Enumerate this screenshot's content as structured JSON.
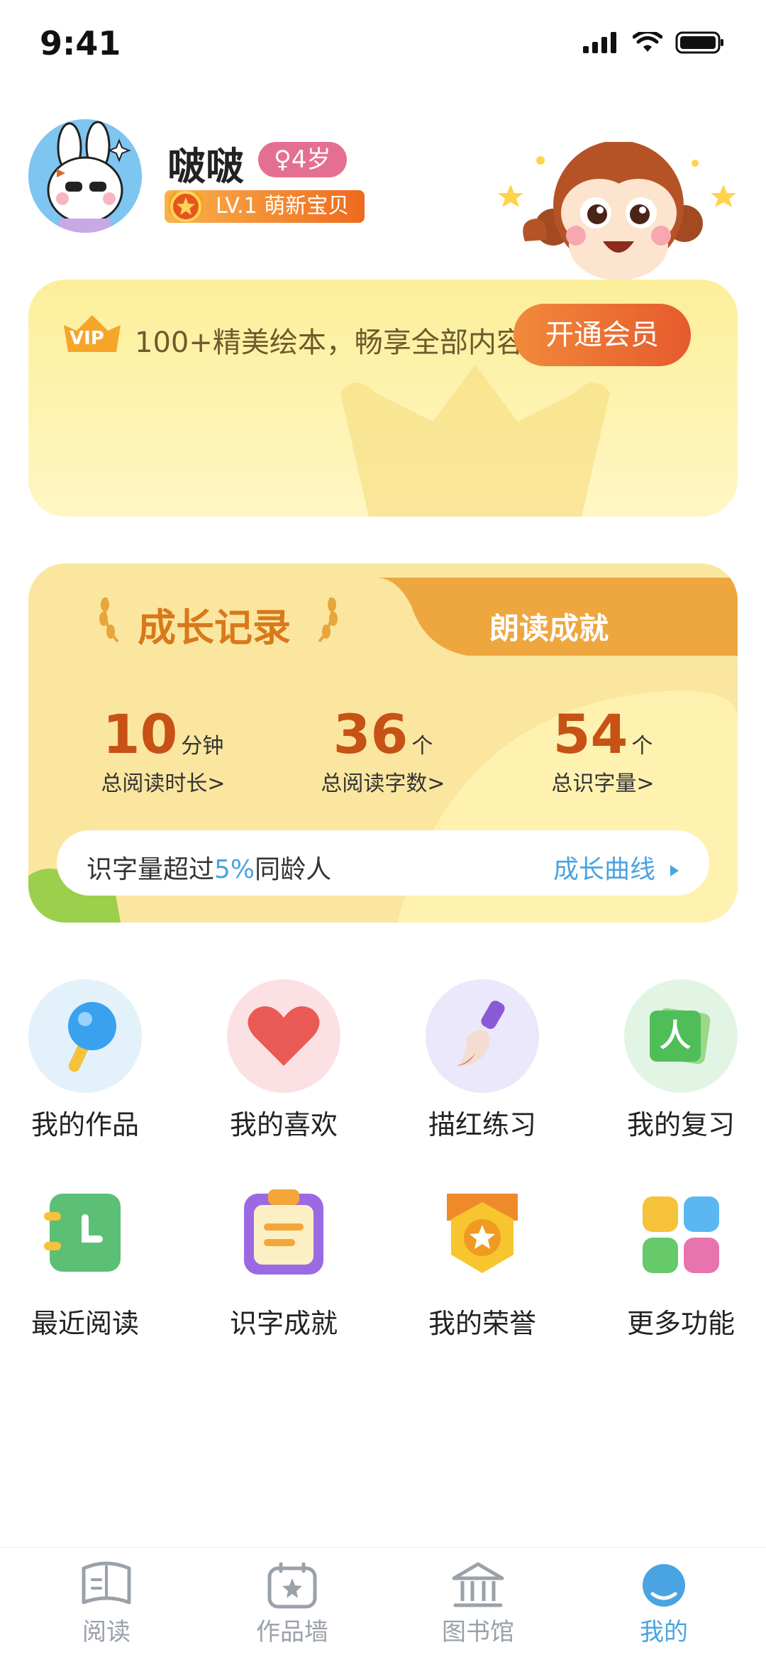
{
  "status_bar": {
    "time": "9:41"
  },
  "profile": {
    "name": "啵啵",
    "age": "♀4岁",
    "level": "LV.1 萌新宝贝"
  },
  "vip": {
    "badge": "VIP",
    "description": "100+精美绘本，畅享全部内容",
    "cta": "开通会员"
  },
  "growth": {
    "title": "成长记录",
    "tab": "朗读成就",
    "stats": [
      {
        "value": "10",
        "unit": "分钟",
        "label": "总阅读时长>"
      },
      {
        "value": "36",
        "unit": "个",
        "label": "总阅读字数>"
      },
      {
        "value": "54",
        "unit": "个",
        "label": "总识字量>"
      }
    ],
    "compare_prefix": "识字量超过",
    "compare_pct": "5%",
    "compare_suffix": "同龄人",
    "curve_link": "成长曲线"
  },
  "features": [
    {
      "label": "我的作品",
      "icon": "lollipop-icon"
    },
    {
      "label": "我的喜欢",
      "icon": "heart-icon"
    },
    {
      "label": "描红练习",
      "icon": "brush-icon"
    },
    {
      "label": "我的复习",
      "icon": "card-icon"
    },
    {
      "label": "最近阅读",
      "icon": "clock-book-icon"
    },
    {
      "label": "识字成就",
      "icon": "clipboard-icon"
    },
    {
      "label": "我的荣誉",
      "icon": "medal-icon"
    },
    {
      "label": "更多功能",
      "icon": "grid-icon"
    }
  ],
  "tabbar": [
    {
      "label": "阅读",
      "active": false
    },
    {
      "label": "作品墙",
      "active": false
    },
    {
      "label": "图书馆",
      "active": false
    },
    {
      "label": "我的",
      "active": true
    }
  ],
  "colors": {
    "accent_orange": "#e65a2d",
    "accent_blue": "#4aa4e2",
    "inactive_gray": "#9aa1a9",
    "vip_yellow": "#fcef9a"
  }
}
